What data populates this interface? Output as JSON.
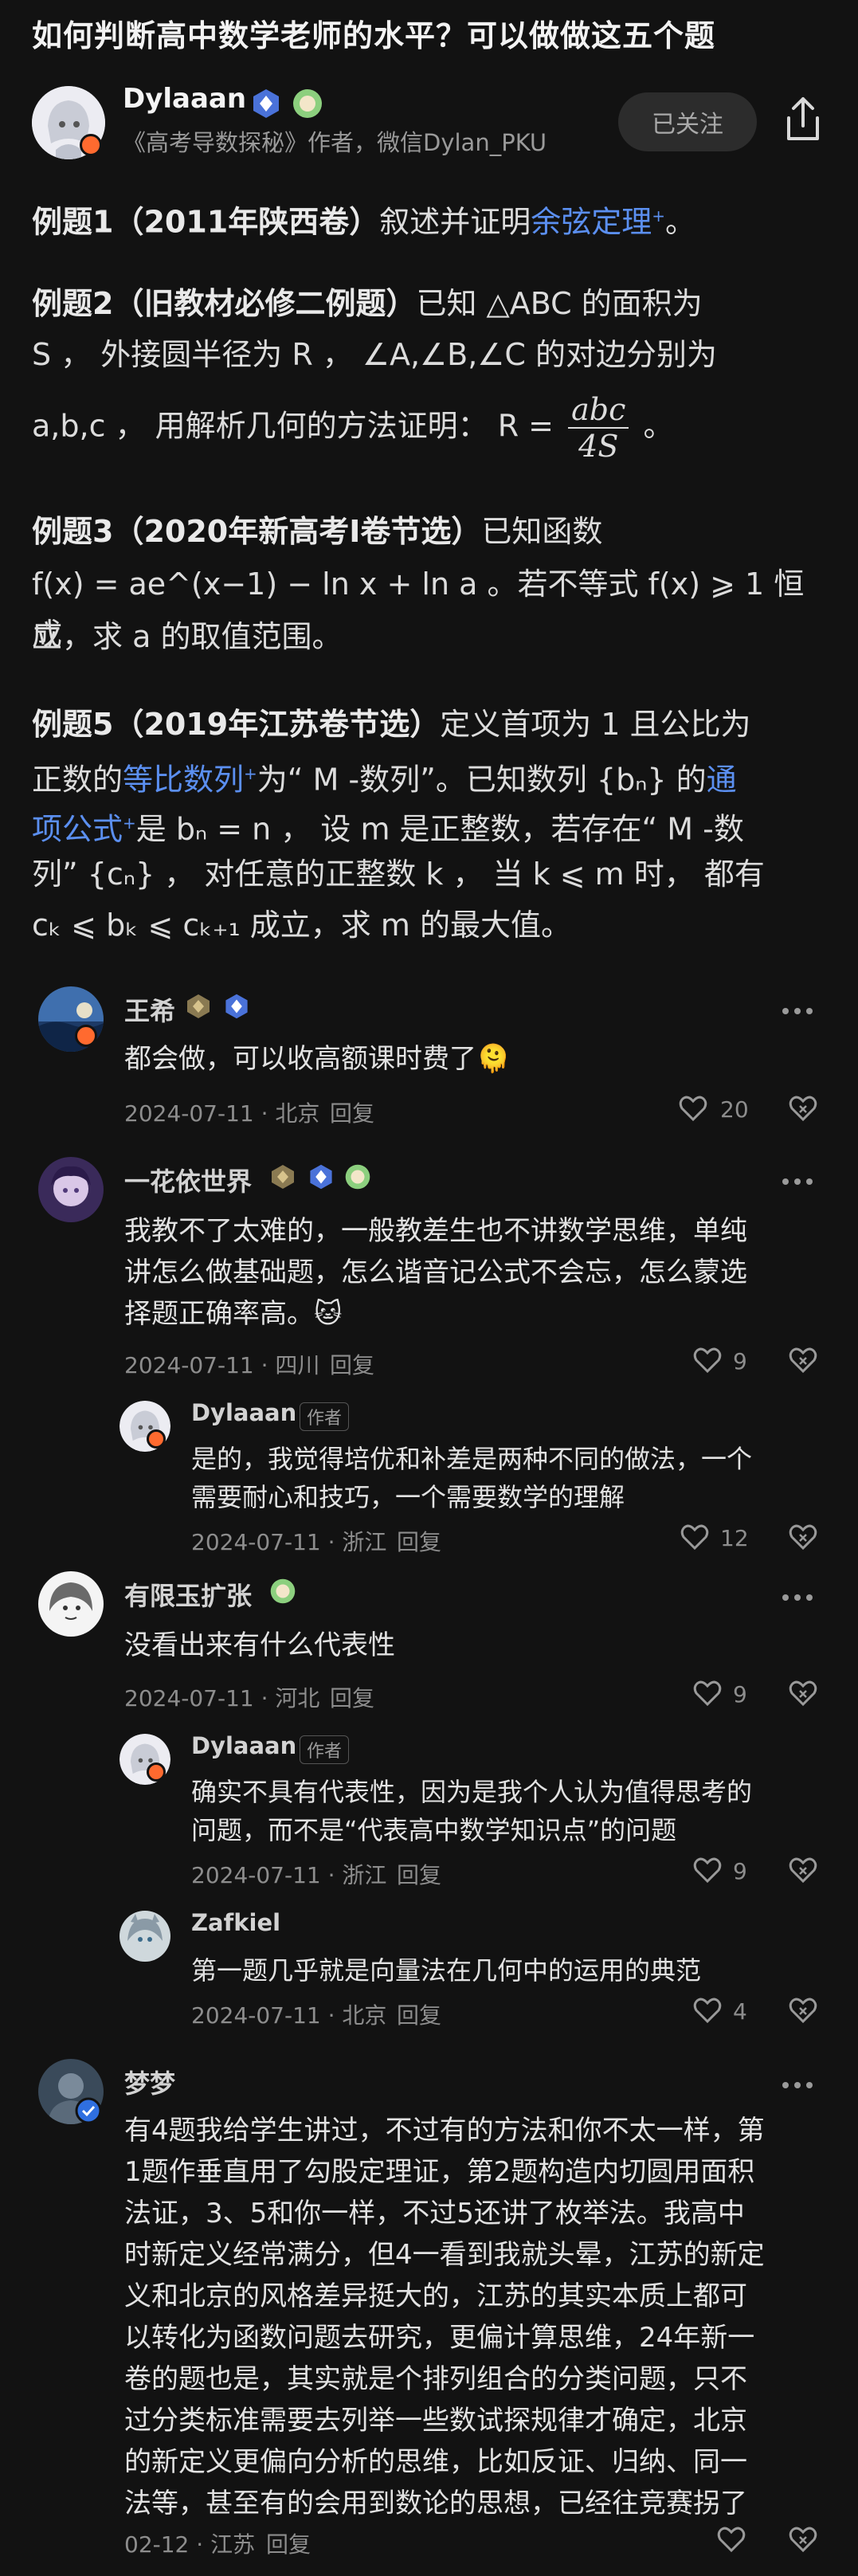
{
  "header": {
    "title": "如何判断高中数学老师的水平？可以做做这五个题"
  },
  "author": {
    "name": "Dylaaan",
    "description": "《高考导数探秘》作者，微信Dylan_PKU",
    "follow_label": "已关注"
  },
  "post": {
    "ex1_label": "例题1（2011年陕西卷）",
    "ex1_text": "叙述并证明",
    "ex1_link": "余弦定理",
    "ex1_end": "。",
    "ex2_label": "例题2（旧教材必修二例题）",
    "ex2_line1": "已知 △ABC 的面积为",
    "ex2_line2": "S ， 外接圆半径为 R ， ∠A,∠B,∠C 的对边分别为",
    "ex2_line3a": "a,b,c ， 用解析几何的方法证明：  R =",
    "ex2_frac_num": "abc",
    "ex2_frac_den": "4S",
    "ex2_line3b": "。",
    "ex3_label": "例题3（2020年新高考I卷节选）",
    "ex3_line1": "已知函数",
    "ex3_line2": "f(x) = ae^(x−1) − ln x + ln a 。若不等式 f(x) ⩾ 1 恒成",
    "ex3_line3": "立，求 a 的取值范围。",
    "ex5_label": "例题5（2019年江苏卷节选）",
    "ex5_line1": "定义首项为 1 且公比为",
    "ex5_line2a": "正数的",
    "ex5_link1": "等比数列",
    "ex5_line2b": "为“ M -数列”。已知数列 {bₙ} 的",
    "ex5_link2a": "通",
    "ex5_link2b": "项公式",
    "ex5_line3": "是 bₙ = n ， 设 m 是正整数，若存在“ M -数",
    "ex5_line4": "列” {cₙ} ， 对任意的正整数 k ， 当 k ⩽ m 时， 都有",
    "ex5_line5": "cₖ ⩽ bₖ ⩽ cₖ₊₁ 成立，求 m 的最大值。"
  },
  "comments": [
    {
      "name": "王希",
      "text": "都会做，可以收高额课时费了🫠",
      "date": "2024-07-11 · 北京",
      "reply": "回复",
      "likes": "20"
    },
    {
      "name": "一花依世界",
      "text1": "我教不了太难的，一般教差生也不讲数学思维，单纯",
      "text2": "讲怎么做基础题，怎么谐音记公式不会忘，怎么蒙选",
      "text3": "择题正确率高。🐱",
      "date": "2024-07-11 · 四川",
      "reply": "回复",
      "likes": "9"
    },
    {
      "name": "Dylaaan",
      "tag": "作者",
      "text1": "是的，我觉得培优和补差是两种不同的做法，一个",
      "text2": "需要耐心和技巧，一个需要数学的理解",
      "date": "2024-07-11 · 浙江",
      "reply": "回复",
      "likes": "12"
    },
    {
      "name": "有限玉扩张",
      "text": "没看出来有什么代表性",
      "date": "2024-07-11 · 河北",
      "reply": "回复",
      "likes": "9"
    },
    {
      "name": "Dylaaan",
      "tag": "作者",
      "text1": "确实不具有代表性，因为是我个人认为值得思考的",
      "text2": "问题，而不是“代表高中数学知识点”的问题",
      "date": "2024-07-11 · 浙江",
      "reply": "回复",
      "likes": "9"
    },
    {
      "name": "Zafkiel",
      "text": "第一题几乎就是向量法在几何中的运用的典范",
      "date": "2024-07-11 · 北京",
      "reply": "回复",
      "likes": "4"
    },
    {
      "name": "梦梦",
      "lines": [
        "有4题我给学生讲过，不过有的方法和你不太一样，第",
        "1题作垂直用了勾股定理证，第2题构造内切圆用面积",
        "法证，3、5和你一样，不过5还讲了枚举法。我高中",
        "时新定义经常满分，但4一看到我就头晕，江苏的新定",
        "义和北京的风格差异挺大的，江苏的其实本质上都可",
        "以转化为函数问题去研究，更偏计算思维，24年新一",
        "卷的题也是，其实就是个排列组合的分类问题，只不",
        "过分类标准需要去列举一些数试探规律才确定，北京",
        "的新定义更偏向分析的思维，比如反证、归纳、同一",
        "法等，甚至有的会用到数论的思想，已经往竞赛拐了"
      ],
      "date": "02-12 · 江苏",
      "reply": "回复"
    }
  ],
  "colors": {
    "link": "#5b8ff0",
    "background": "#121212",
    "vip_badge": "#ff6a2f"
  }
}
